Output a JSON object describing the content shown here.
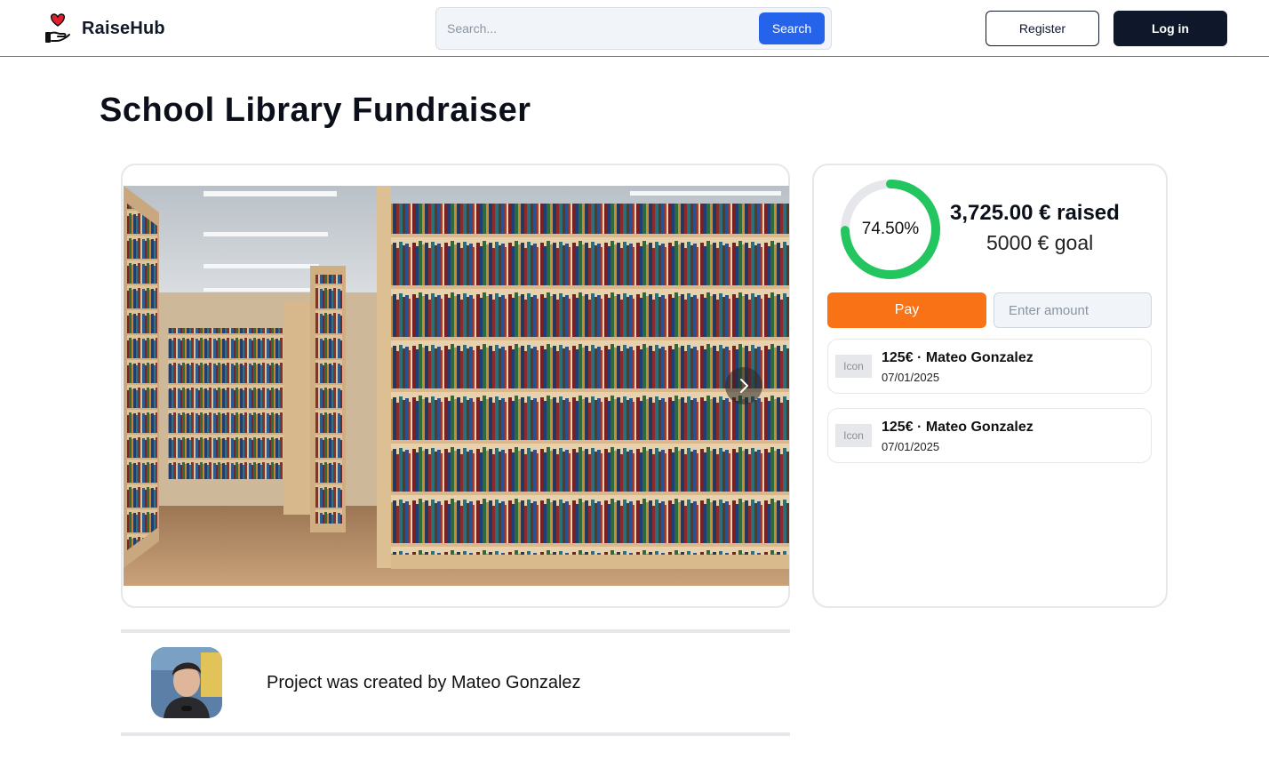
{
  "app": {
    "name": "RaiseHub"
  },
  "search": {
    "placeholder": "Search...",
    "button_label": "Search"
  },
  "auth": {
    "register_label": "Register",
    "login_label": "Log in"
  },
  "project": {
    "title": "School Library Fundraiser",
    "progress_percent_label": "74.50%",
    "progress_fraction": 0.745,
    "raised_label": "3,725.00 € raised",
    "goal_label": "5000 € goal",
    "creator_text": "Project was created by Mateo Gonzalez"
  },
  "payment": {
    "pay_label": "Pay",
    "amount_placeholder": "Enter amount"
  },
  "donations": [
    {
      "icon_label": "Icon",
      "title": "125€ · Mateo Gonzalez",
      "date": "07/01/2025"
    },
    {
      "icon_label": "Icon",
      "title": "125€ · Mateo Gonzalez",
      "date": "07/01/2025"
    }
  ],
  "colors": {
    "primary": "#2563eb",
    "dark": "#0f172a",
    "accent_orange": "#f97316",
    "progress_green": "#22c55e",
    "progress_track": "#e5e7eb"
  },
  "icons": {
    "logo": "heart-hand-icon",
    "carousel_next": "chevron-right-icon"
  }
}
